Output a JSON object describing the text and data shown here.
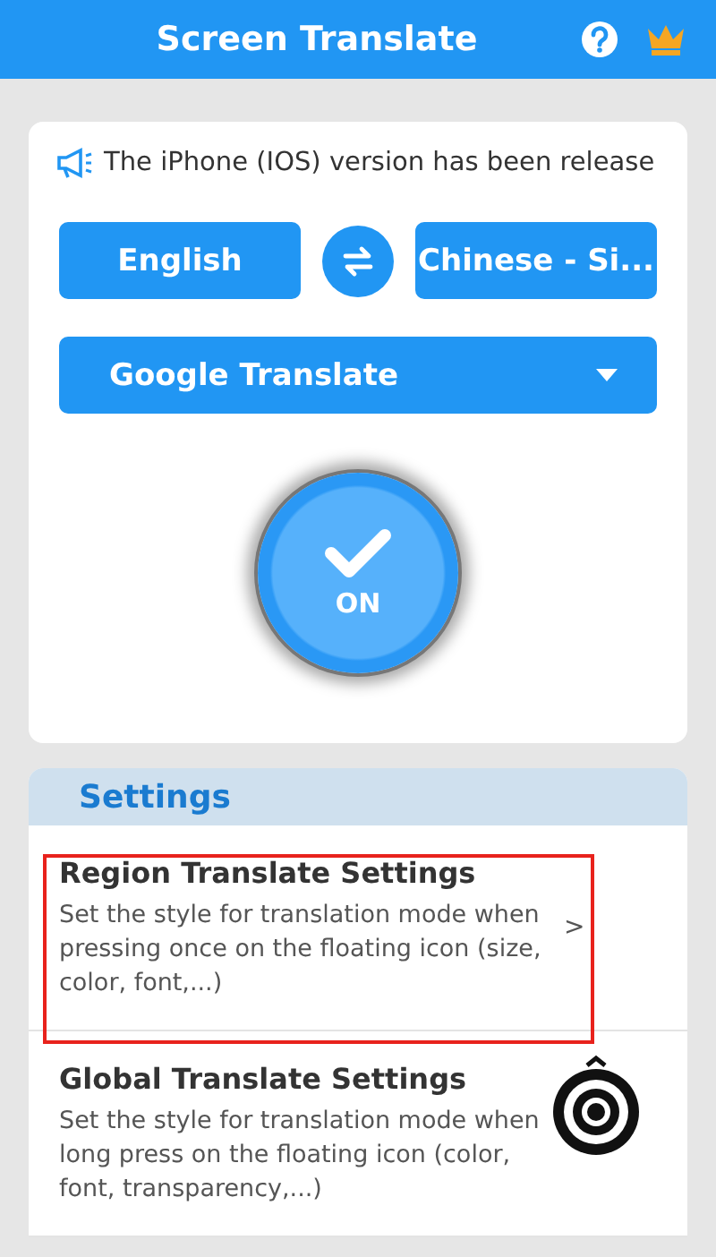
{
  "header": {
    "title": "Screen Translate"
  },
  "notice": {
    "text": "The iPhone (IOS) version has been release"
  },
  "languages": {
    "source": "English",
    "target": "Chinese - Si..."
  },
  "engine": {
    "label": "Google Translate"
  },
  "power": {
    "label": "ON",
    "on": true
  },
  "settings": {
    "title": "Settings",
    "items": [
      {
        "title": "Region Translate Settings",
        "description": "Set the style for translation mode when pressing once on the floating icon (size, color, font,...)",
        "chevron": ">",
        "highlighted": true
      },
      {
        "title": "Global Translate Settings",
        "description": "Set the style for translation mode when long press on the floating icon (color, font, transparency,...)",
        "highlighted": false
      }
    ]
  }
}
